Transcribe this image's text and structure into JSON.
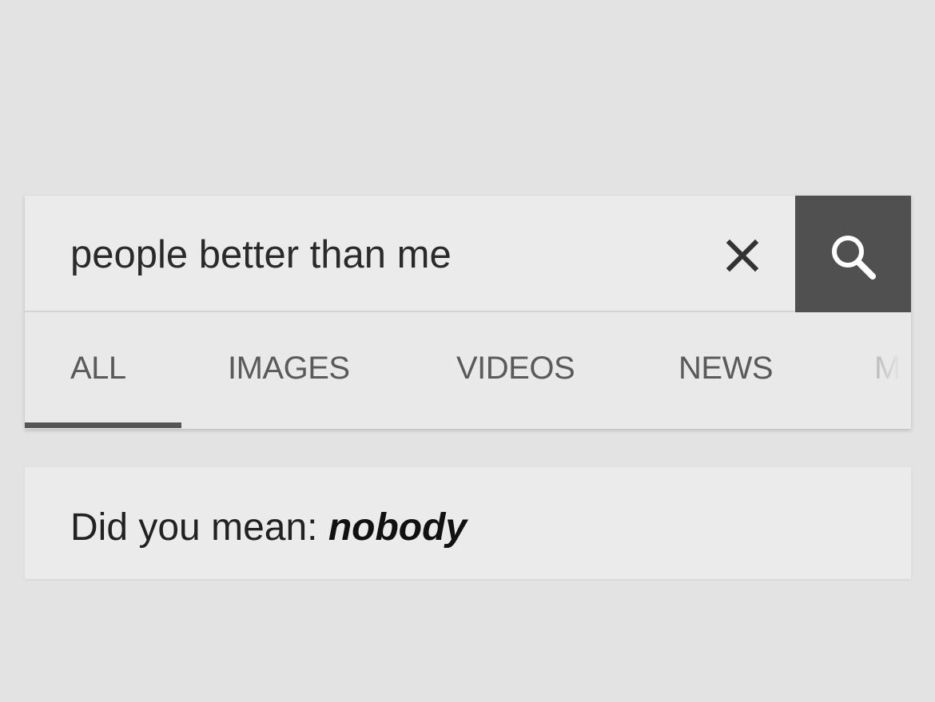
{
  "search": {
    "query": "people better than me",
    "clear_icon": "close-icon",
    "submit_icon": "search-icon"
  },
  "tabs": [
    {
      "label": "ALL",
      "active": true
    },
    {
      "label": "IMAGES",
      "active": false
    },
    {
      "label": "VIDEOS",
      "active": false
    },
    {
      "label": "NEWS",
      "active": false
    },
    {
      "label": "M",
      "active": false
    }
  ],
  "suggestion": {
    "prefix": "Did you mean: ",
    "term": "nobody"
  },
  "colors": {
    "background": "#e3e3e3",
    "search_button": "#505050",
    "active_tab_indicator": "#555555"
  }
}
